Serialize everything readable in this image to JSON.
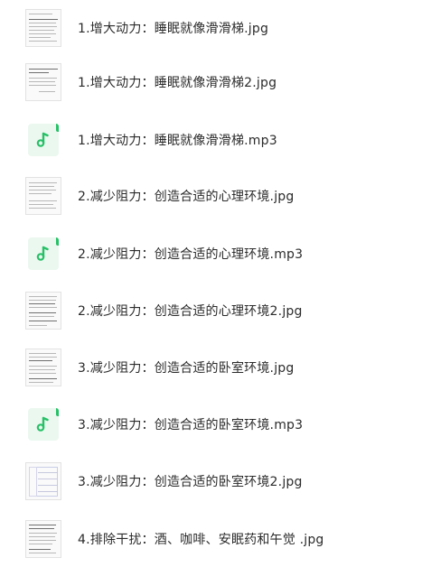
{
  "files": [
    {
      "name": "1.增大动力：睡眠就像滑滑梯.jpg",
      "type": "image",
      "icon": "document-image-icon"
    },
    {
      "name": "1.增大动力：睡眠就像滑滑梯2.jpg",
      "type": "image",
      "icon": "document-image-icon"
    },
    {
      "name": "1.增大动力：睡眠就像滑滑梯.mp3",
      "type": "audio",
      "icon": "music-note-icon"
    },
    {
      "name": "2.减少阻力：创造合适的心理环境.jpg",
      "type": "image",
      "icon": "document-image-icon"
    },
    {
      "name": "2.减少阻力：创造合适的心理环境.mp3",
      "type": "audio",
      "icon": "music-note-icon"
    },
    {
      "name": "2.减少阻力：创造合适的心理环境2.jpg",
      "type": "image",
      "icon": "document-image-icon"
    },
    {
      "name": "3.减少阻力：创造合适的卧室环境.jpg",
      "type": "image",
      "icon": "document-image-icon"
    },
    {
      "name": "3.减少阻力：创造合适的卧室环境.mp3",
      "type": "audio",
      "icon": "music-note-icon"
    },
    {
      "name": "3.减少阻力：创造合适的卧室环境2.jpg",
      "type": "image",
      "icon": "table-image-icon"
    },
    {
      "name": "4.排除干扰：酒、咖啡、安眠药和午觉 .jpg",
      "type": "image",
      "icon": "document-image-icon"
    }
  ],
  "colors": {
    "audio_bg": "#ebf8ef",
    "audio_accent": "#27c067",
    "text": "#2b2b2b"
  }
}
